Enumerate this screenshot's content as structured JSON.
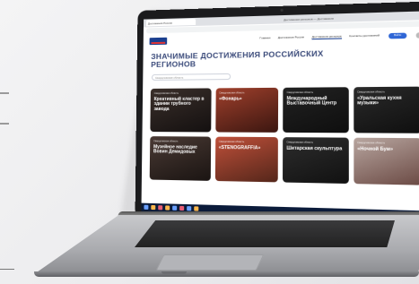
{
  "browser": {
    "tab_label": "Достижения России",
    "window_title": "Достижения регионов — Достижения"
  },
  "site": {
    "nav": [
      "Главная",
      "Достижения России",
      "Достижения регионов",
      "Контакты достижений"
    ],
    "cta_label": "Войти",
    "page_title_line1": "ЗНАЧИМЫЕ ДОСТИЖЕНИЯ РОССИЙСКИХ",
    "page_title_line2": "РЕГИОНОВ",
    "filter_placeholder": "Свердловская область"
  },
  "cards": [
    {
      "region": "Свердловская область",
      "name": "Креативный кластер в здании трубного завода"
    },
    {
      "region": "Свердловская область",
      "name": "«Фонарь»"
    },
    {
      "region": "Свердловская область",
      "name": "Международный Выставочный Центр"
    },
    {
      "region": "Свердловская область",
      "name": "«Уральская кухня музыки»"
    },
    {
      "region": "Свердловская область",
      "name": "Музейное наследие Вовин Демидовых"
    },
    {
      "region": "Свердловская область",
      "name": "«STENOGRAFFIA»"
    },
    {
      "region": "Свердловская область",
      "name": "Шитарская скульптура"
    },
    {
      "region": "Свердловская область",
      "name": "«Ночной Бум»"
    }
  ]
}
